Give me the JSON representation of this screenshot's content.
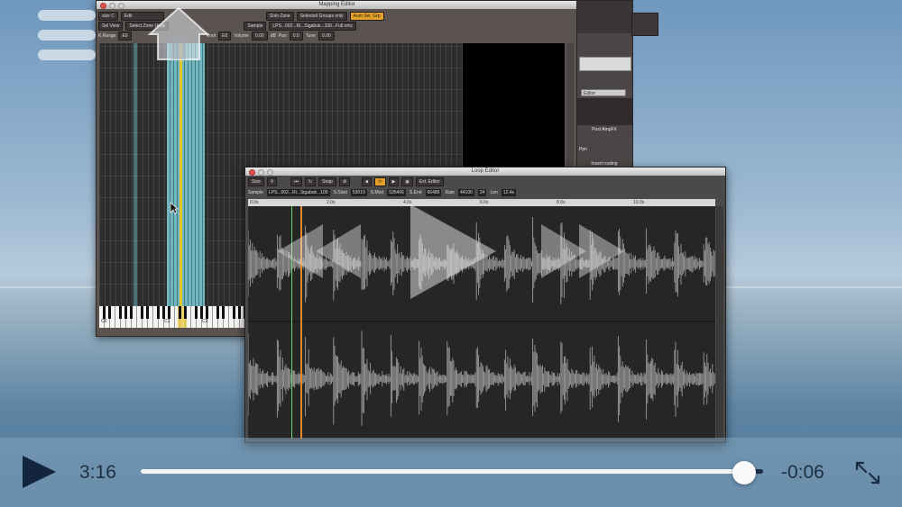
{
  "mapping_editor": {
    "title": "Mapping Editor",
    "toolbar_row1": [
      "size C",
      "Edit",
      "Solo Zone",
      "Selected Groups only",
      "Auto Sel. Grp"
    ],
    "toolbar_row2": [
      "Sel View",
      "Select Zone Unde"
    ],
    "info_row": {
      "krange_label": "K.Range",
      "krange_value": "E0",
      "root_label": "Root",
      "root_value": "E0",
      "volume_label": "Volume",
      "volume_value": "0.00",
      "volume_unit": "dB",
      "pan_label": "Pan",
      "pan_value": "0.0",
      "tune_label": "Tune",
      "tune_value": "0.00",
      "sample_label": "Sample",
      "sample_value": "LPS...002...Ri...Sigabuk...100...Full.nmc"
    },
    "keyboard_labels": [
      "C0",
      "C1",
      "C2"
    ]
  },
  "side_panel": {
    "button_label": "Editor",
    "label": "Post AmpFX",
    "sub_label": "Ppn",
    "strip_label": "Insert routing"
  },
  "loop_editor": {
    "title": "Loop Editor",
    "toolbar": [
      "Size",
      "Snap",
      "Ext. Editor"
    ],
    "info": {
      "sample_label": "Sample",
      "sample_value": "LPS...002...Ri...Sigabuk...100",
      "sstart_label": "S.Start",
      "sstart_value": "53019",
      "smod_label": "S.Mod",
      "smod_value": "535406",
      "send_label": "S.End",
      "send_value": "66489",
      "rate_label": "Rate",
      "rate_value": "44100",
      "bits_value": "24",
      "len_label": "Len",
      "len_value": "12.4s"
    },
    "ruler_ticks": [
      "0.0s",
      "2.0s",
      "4.0s",
      "6.0s",
      "8.0s",
      "10.0s"
    ]
  },
  "player": {
    "elapsed": "3:16",
    "remaining": "-0:06",
    "progress": 0.97
  },
  "icons": {
    "menu": "menu-icon",
    "home": "home-icon",
    "play": "play-icon",
    "rewind": "rewind-icon",
    "fast_forward": "fast-forward-icon",
    "expand": "expand-icon"
  },
  "colors": {
    "zone_teal": "#6ec8d2",
    "root_yellow": "#e8c62a",
    "accent_orange": "#e5a12a",
    "control_dark": "#1c2e45"
  }
}
